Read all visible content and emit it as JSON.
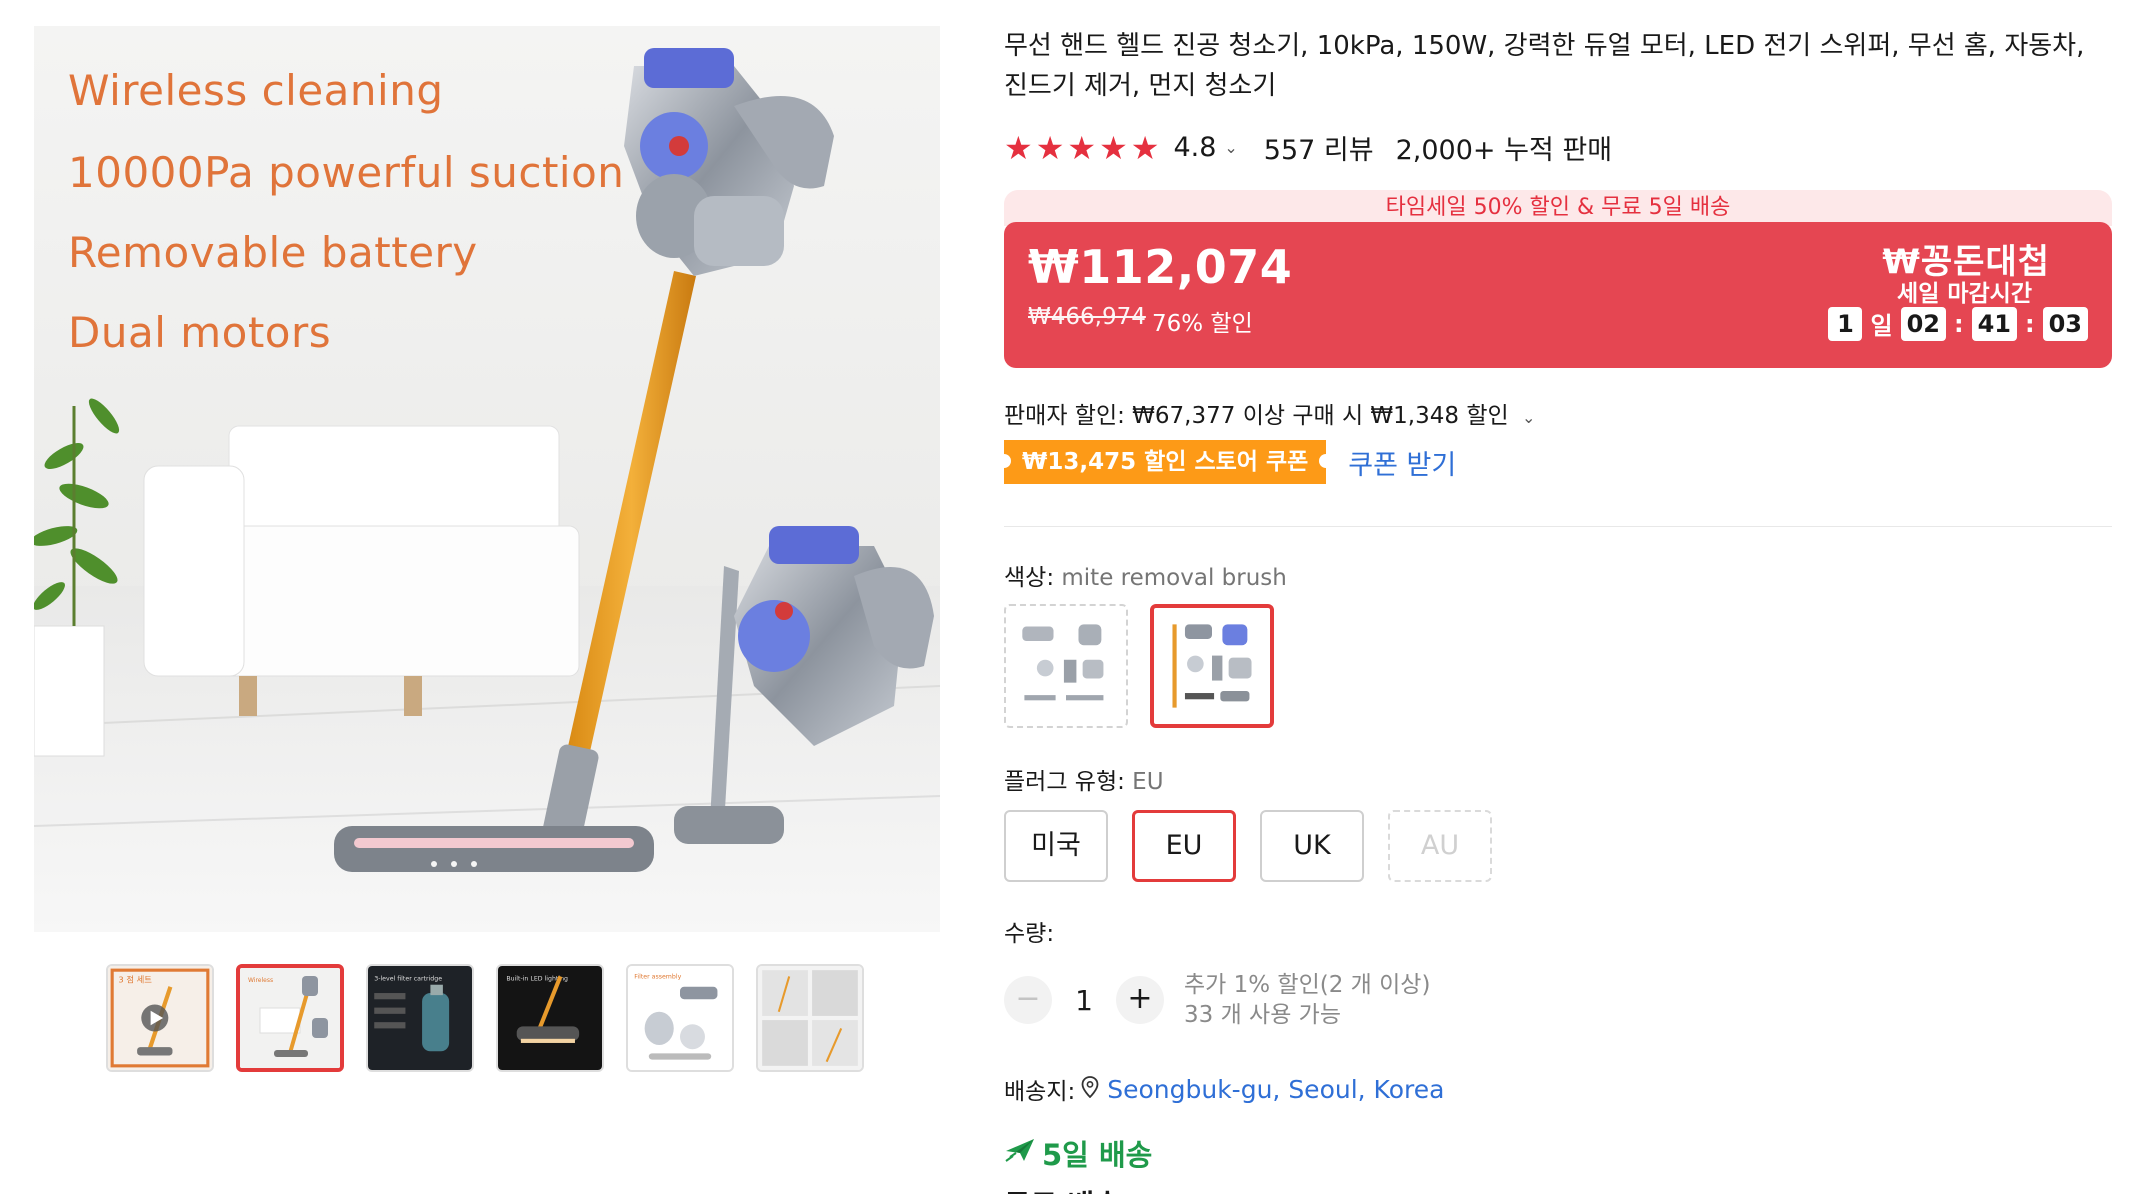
{
  "gallery": {
    "features": [
      "Wireless cleaning",
      "10000Pa powerful suction",
      "Removable battery",
      "Dual motors"
    ],
    "thumbnails": [
      {
        "icon": "play-icon"
      },
      {
        "icon": "vacuum-image"
      },
      {
        "icon": "dark-image"
      },
      {
        "icon": "dark-image"
      },
      {
        "icon": "parts-image"
      },
      {
        "icon": "collage-image"
      }
    ],
    "thumb_captions": {
      "t1": "3 점 세트",
      "t3": "Built-in LED lighting",
      "t5": "Filter assembly"
    }
  },
  "product": {
    "title": "무선 핸드 헬드 진공 청소기, 10kPa, 150W, 강력한 듀얼 모터, LED 전기 스위퍼, 무선 홈, 자동차, 진드기 제거, 먼지 청소기",
    "rating": "4.8",
    "reviews": "557 리뷰",
    "sold": "2,000+ 누적 판매"
  },
  "price": {
    "promo_strip": "타임세일 50% 할인 & 무료 5일 배송",
    "current": "₩112,074",
    "original": "₩466,974",
    "discount": "76% 할인",
    "sale_logo": "₩꽁돈대첩",
    "sale_ends": "세일 마감시간",
    "countdown": {
      "days": "1",
      "day_unit": "일",
      "hours": "02",
      "minutes": "41",
      "seconds": "03"
    },
    "accent_color": "#e54652"
  },
  "seller_discount": "판매자 할인: ₩67,377 이상 구매 시 ₩1,348 할인",
  "coupon": {
    "label": "₩13,475 할인 스토어 쿠폰",
    "action": "쿠폰 받기"
  },
  "color": {
    "label": "색상:",
    "value": " mite removal brush"
  },
  "plug": {
    "label": "플러그 유형:",
    "value": " EU",
    "options": [
      "미국",
      "EU",
      "UK",
      "AU"
    ]
  },
  "quantity": {
    "label": "수량:",
    "value": "1",
    "minus": "−",
    "plus": "+",
    "note_line1": "추가 1% 할인(2 개 이상)",
    "note_line2": "33 개 사용 가능"
  },
  "shipping": {
    "label": "배송지:",
    "location": "Seongbuk-gu, Seoul, Korea",
    "delivery": "5일 배송",
    "free": "무료 배송"
  }
}
